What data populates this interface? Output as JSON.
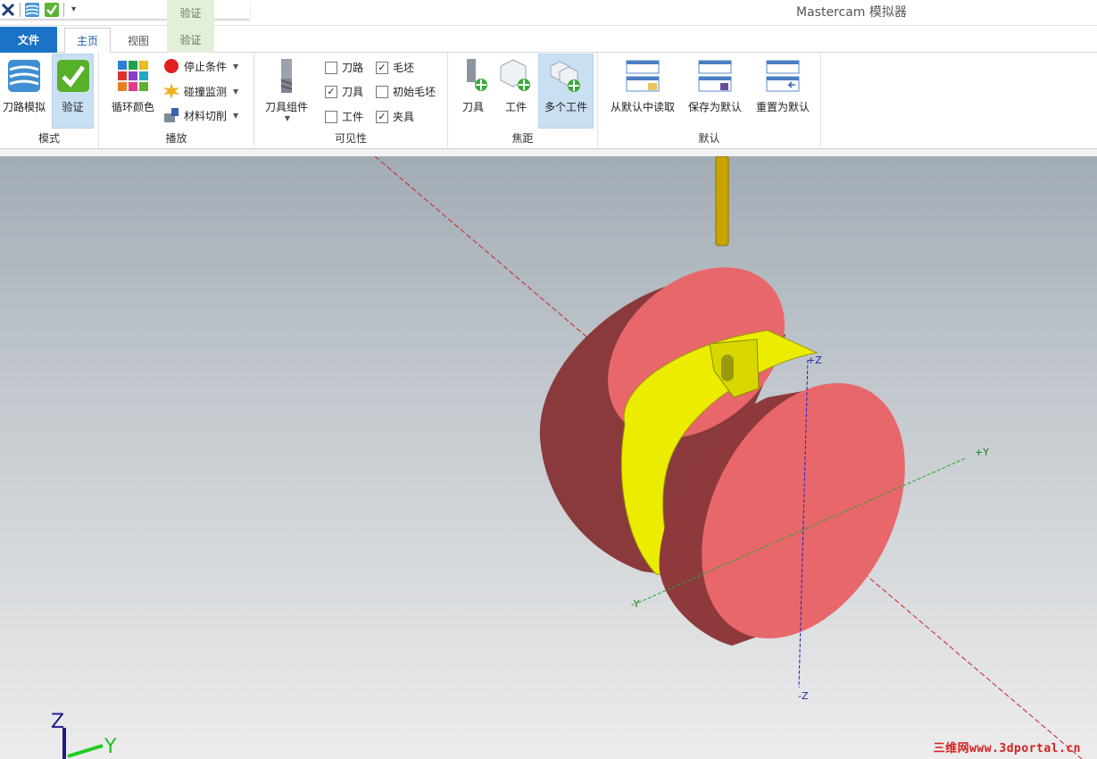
{
  "app": {
    "title": "Mastercam 模拟器",
    "context_tab_group": "验证"
  },
  "tabs": [
    {
      "label": "文件"
    },
    {
      "label": "主页"
    },
    {
      "label": "视图"
    },
    {
      "label": "验证"
    }
  ],
  "groups": {
    "mode": {
      "label": "模式",
      "buttons": [
        {
          "label": "刀路模拟",
          "icon": "toolpath-sim-icon"
        },
        {
          "label": "验证",
          "icon": "verify-check-icon",
          "active": true
        }
      ]
    },
    "playback": {
      "label": "播放",
      "cycle_colors": "循环颜色",
      "stop_conditions": "停止条件",
      "collision_detection": "碰撞监测",
      "material_cut": "材料切削"
    },
    "visibility": {
      "label": "可见性",
      "tool_assembly": "刀具组件",
      "checks": [
        {
          "label": "刀路",
          "checked": false
        },
        {
          "label": "毛坯",
          "checked": true
        },
        {
          "label": "刀具",
          "checked": true
        },
        {
          "label": "初始毛坯",
          "checked": false
        },
        {
          "label": "工件",
          "checked": false
        },
        {
          "label": "夹具",
          "checked": true
        }
      ]
    },
    "focus": {
      "label": "焦距",
      "buttons": [
        {
          "label": "刀具"
        },
        {
          "label": "工件"
        },
        {
          "label": "多个工件",
          "active": true
        }
      ]
    },
    "defaults": {
      "label": "默认",
      "buttons": [
        {
          "label": "从默认中读取"
        },
        {
          "label": "保存为默认"
        },
        {
          "label": "重置为默认"
        }
      ]
    }
  },
  "viewport": {
    "axes": {
      "plus_z": "+Z",
      "minus_z": "-Z",
      "plus_y": "+Y",
      "minus_y": "-Y"
    },
    "triad": {
      "z": "Z",
      "y": "Y"
    },
    "colors": {
      "stock": "#e8676a",
      "fixture": "#ecec00",
      "tool": "#c9a400",
      "x_axis": "#cc2222",
      "y_axis": "#22aa22",
      "z_axis": "#2222cc"
    },
    "watermark": "三维网www.3dportal.cn"
  }
}
